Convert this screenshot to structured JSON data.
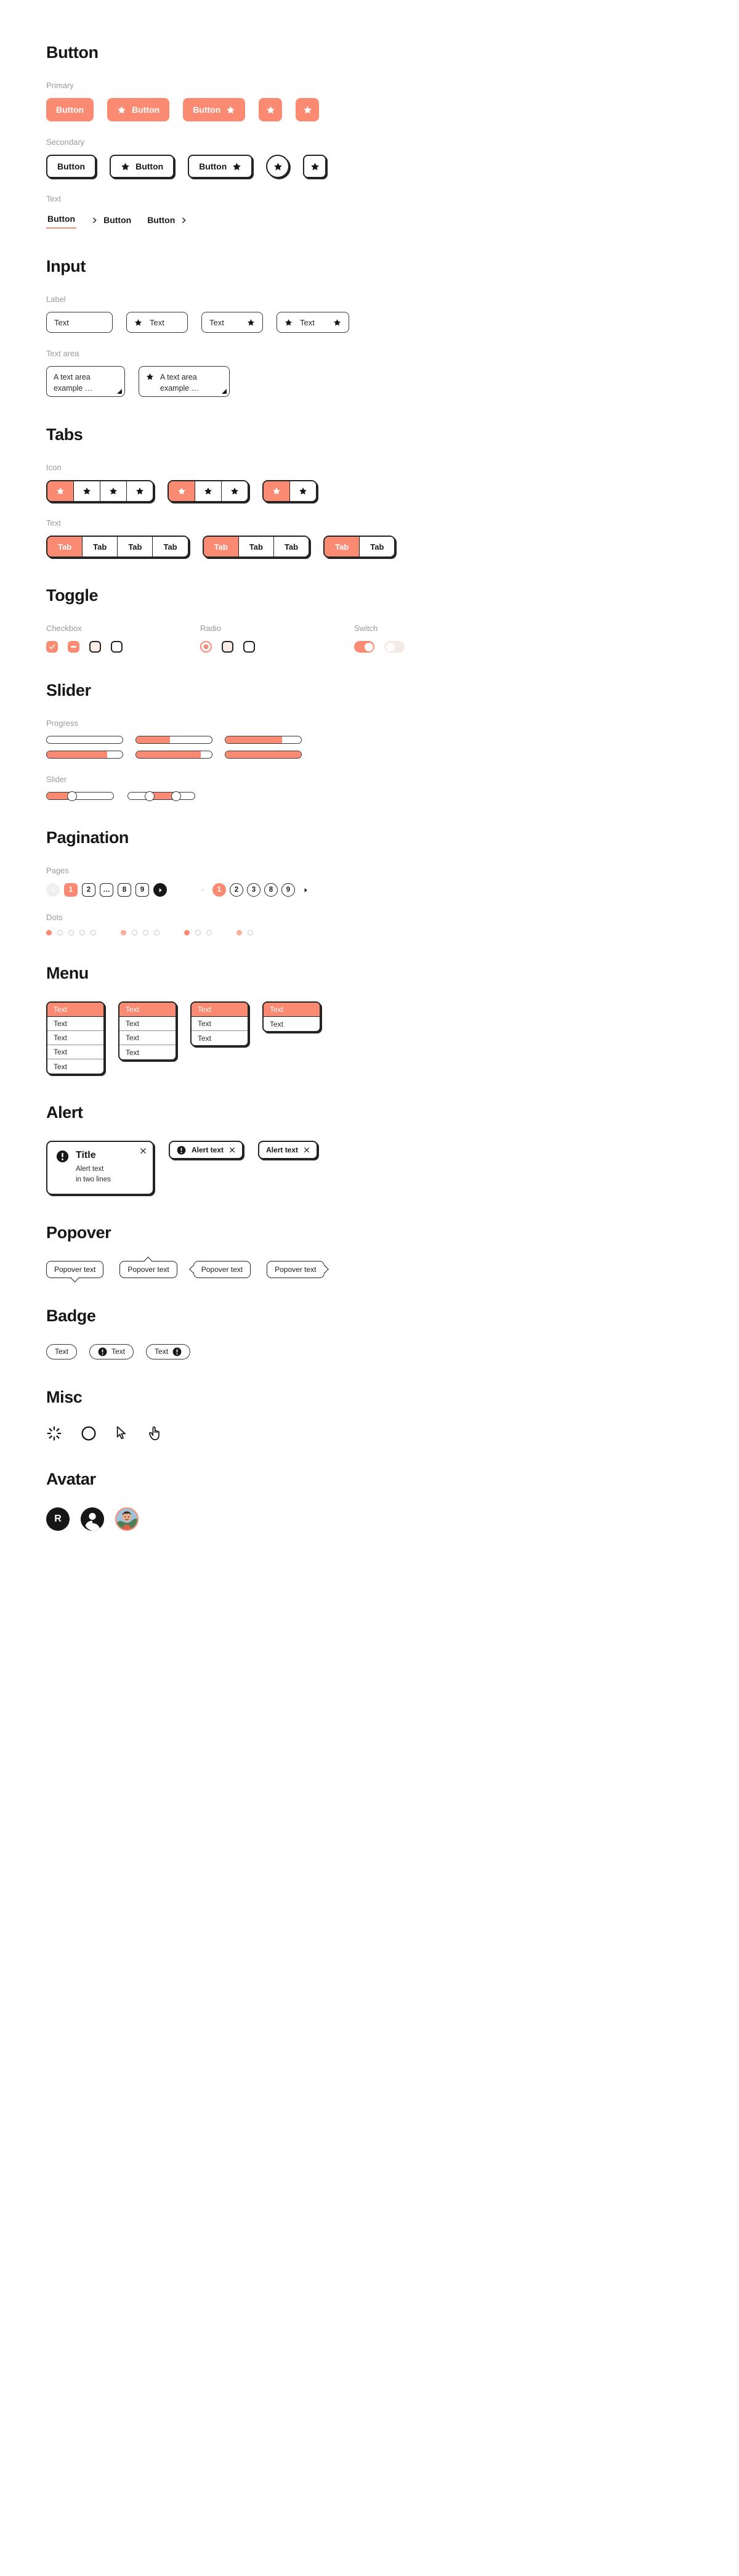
{
  "theme": {
    "accent": "#FA8A71",
    "accent_soft": "#FDEDE7",
    "ink": "#171717",
    "muted": "#9a9a9a",
    "border": "#242424",
    "surface": "#ffffff"
  },
  "sections": {
    "button": {
      "title": "Button",
      "primary_label": "Primary",
      "secondary_label": "Secondary",
      "text_label": "Text",
      "primary": [
        {
          "text": "Button",
          "icon": "none"
        },
        {
          "text": "Button",
          "icon": "star-leading"
        },
        {
          "text": "Button",
          "icon": "star-trailing"
        },
        {
          "text": "",
          "icon": "star-only"
        },
        {
          "text": "",
          "icon": "star-only"
        }
      ],
      "secondary": [
        {
          "text": "Button",
          "icon": "none"
        },
        {
          "text": "Button",
          "icon": "star-leading"
        },
        {
          "text": "Button",
          "icon": "star-trailing"
        },
        {
          "text": "",
          "icon": "star-only"
        },
        {
          "text": "",
          "icon": "star-only"
        }
      ],
      "text_buttons": [
        {
          "text": "Button",
          "icon": "none",
          "underline": true
        },
        {
          "text": "Button",
          "icon": "chevron-leading",
          "underline": false
        },
        {
          "text": "Button",
          "icon": "chevron-trailing",
          "underline": false
        }
      ]
    },
    "input": {
      "title": "Input",
      "label_label": "Label",
      "textarea_label": "Text area",
      "fields": [
        {
          "value": "Text",
          "icon": "none"
        },
        {
          "value": "Text",
          "icon": "star-leading"
        },
        {
          "value": "Text",
          "icon": "star-trailing"
        },
        {
          "value": "Text",
          "icon": "star-both"
        }
      ],
      "textareas": [
        {
          "value": "A text area example …",
          "icon": "none"
        },
        {
          "value": "A text area example …",
          "icon": "star-leading"
        }
      ]
    },
    "tabs": {
      "title": "Tabs",
      "icon_label": "Icon",
      "text_label": "Text",
      "icon_groups": [
        {
          "count": 4,
          "active": 0
        },
        {
          "count": 3,
          "active": 0
        },
        {
          "count": 2,
          "active": 0
        }
      ],
      "text_groups": [
        {
          "items": [
            "Tab",
            "Tab",
            "Tab",
            "Tab"
          ],
          "active": 0
        },
        {
          "items": [
            "Tab",
            "Tab",
            "Tab"
          ],
          "active": 0
        },
        {
          "items": [
            "Tab",
            "Tab"
          ],
          "active": 0
        }
      ]
    },
    "toggle": {
      "title": "Toggle",
      "checkbox_label": "Checkbox",
      "radio_label": "Radio",
      "switch_label": "Switch",
      "checkboxes": [
        "checked",
        "indeterminate",
        "hover",
        "unchecked"
      ],
      "radios": [
        "selected",
        "hover",
        "unselected"
      ],
      "switches": [
        "on",
        "off"
      ]
    },
    "slider": {
      "title": "Slider",
      "progress_label": "Progress",
      "slider_label": "Slider",
      "progress_row1": [
        0,
        45,
        75
      ],
      "progress_row2": [
        80,
        85,
        100
      ],
      "sliders": [
        {
          "value": 38
        },
        {
          "value": 32,
          "value2": 72
        }
      ]
    },
    "pagination": {
      "title": "Pagination",
      "pages_label": "Pages",
      "dots_label": "Dots",
      "pages_outline": {
        "prev": "‹",
        "items": [
          "1",
          "2",
          "…",
          "8",
          "9"
        ],
        "active": "1",
        "next": "›"
      },
      "pages_circle": {
        "prev": "‹",
        "items": [
          "1",
          "2",
          "3",
          "8",
          "9"
        ],
        "active": "1",
        "next": "›"
      },
      "dot_groups": [
        {
          "count": 5,
          "active": 0
        },
        {
          "count": 4,
          "active": 0
        },
        {
          "count": 3,
          "active": 0
        },
        {
          "count": 2,
          "active": 0
        }
      ]
    },
    "menu": {
      "title": "Menu",
      "menus": [
        {
          "items": [
            "Text",
            "Text",
            "Text",
            "Text",
            "Text"
          ],
          "active": 0
        },
        {
          "items": [
            "Text",
            "Text",
            "Text",
            "Text"
          ],
          "active": 0
        },
        {
          "items": [
            "Text",
            "Text",
            "Text"
          ],
          "active": 0
        },
        {
          "items": [
            "Text",
            "Text"
          ],
          "active": 0
        }
      ]
    },
    "alert": {
      "title": "Alert",
      "large": {
        "title": "Title",
        "line1": "Alert text",
        "line2": "in two lines",
        "close": "×"
      },
      "small": [
        {
          "text": "Alert text",
          "icon": "exclamation",
          "close": "×"
        },
        {
          "text": "Alert text",
          "icon": "none",
          "close": "×"
        }
      ]
    },
    "popover": {
      "title": "Popover",
      "items": [
        {
          "text": "Popover text",
          "arrow": "bottom"
        },
        {
          "text": "Popover text",
          "arrow": "top"
        },
        {
          "text": "Popover text",
          "arrow": "left"
        },
        {
          "text": "Popover text",
          "arrow": "right"
        }
      ]
    },
    "badge": {
      "title": "Badge",
      "items": [
        {
          "text": "Text",
          "icon": "none"
        },
        {
          "text": "Text",
          "icon": "exclamation-leading"
        },
        {
          "text": "Text",
          "icon": "exclamation-trailing"
        }
      ]
    },
    "misc": {
      "title": "Misc",
      "items": [
        "spinner-icon",
        "ring-icon",
        "cursor-arrow-icon",
        "pointing-hand-icon"
      ]
    },
    "avatar": {
      "title": "Avatar",
      "items": [
        {
          "kind": "initial",
          "value": "R"
        },
        {
          "kind": "silhouette",
          "value": ""
        },
        {
          "kind": "photo",
          "value": ""
        }
      ]
    }
  }
}
